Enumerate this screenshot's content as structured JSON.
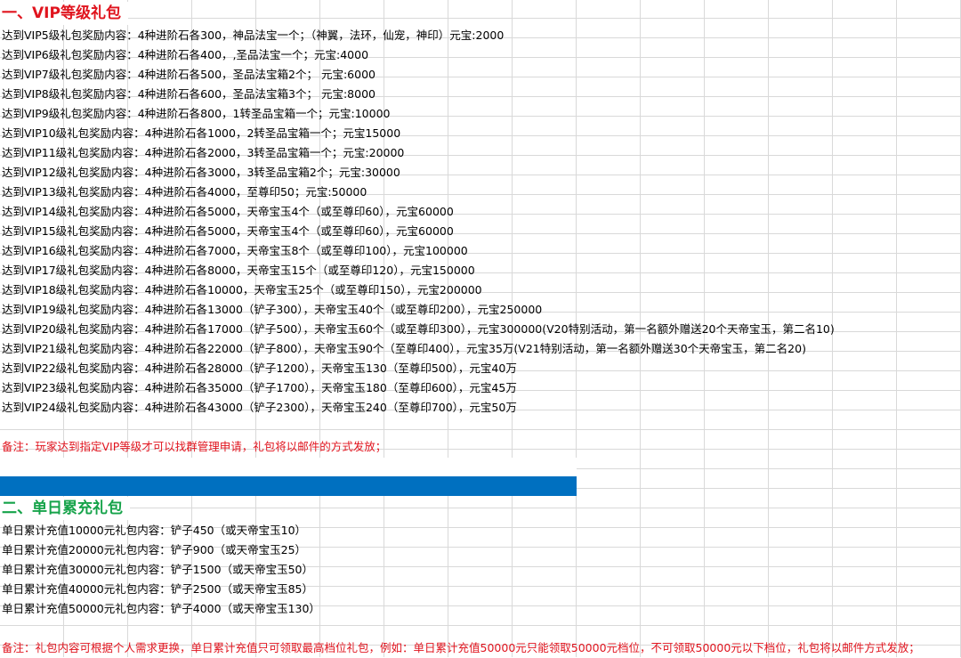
{
  "section1": {
    "title": "一、VIP等级礼包",
    "rows": [
      "达到VIP5级礼包奖励内容：4种进阶石各300，神品法宝一个；（神翼，法环，仙宠，神印）元宝:2000",
      "达到VIP6级礼包奖励内容：4种进阶石各400，,圣品法宝一个；元宝:4000",
      "达到VIP7级礼包奖励内容：4种进阶石各500，圣品法宝箱2个； 元宝:6000",
      "达到VIP8级礼包奖励内容：4种进阶石各600，圣品法宝箱3个； 元宝:8000",
      "达到VIP9级礼包奖励内容：4种进阶石各800，1转圣品宝箱一个；元宝:10000",
      "达到VIP10级礼包奖励内容：4种进阶石各1000，2转圣品宝箱一个；元宝15000",
      "达到VIP11级礼包奖励内容：4种进阶石各2000，3转圣品宝箱一个；元宝:20000",
      "达到VIP12级礼包奖励内容：4种进阶石各3000，3转圣品宝箱2个；元宝:30000",
      "达到VIP13级礼包奖励内容：4种进阶石各4000，至尊印50；元宝:50000",
      "达到VIP14级礼包奖励内容：4种进阶石各5000，天帝宝玉4个（或至尊印60），元宝60000",
      "达到VIP15级礼包奖励内容：4种进阶石各5000，天帝宝玉4个（或至尊印60），元宝60000",
      "达到VIP16级礼包奖励内容：4种进阶石各7000，天帝宝玉8个（或至尊印100），元宝100000",
      "达到VIP17级礼包奖励内容：4种进阶石各8000，天帝宝玉15个（或至尊印120），元宝150000",
      "达到VIP18级礼包奖励内容：4种进阶石各10000，天帝宝玉25个（或至尊印150），元宝200000",
      "达到VIP19级礼包奖励内容：4种进阶石各13000（铲子300），天帝宝玉40个（或至尊印200），元宝250000",
      "达到VIP20级礼包奖励内容：4种进阶石各17000（铲子500），天帝宝玉60个（或至尊印300），元宝300000(V20特别活动，第一名额外赠送20个天帝宝玉，第二名10)",
      "达到VIP21级礼包奖励内容：4种进阶石各22000（铲子800），天帝宝玉90个（至尊印400），元宝35万(V21特别活动，第一名额外赠送30个天帝宝玉，第二名20)",
      "达到VIP22级礼包奖励内容：4种进阶石各28000（铲子1200），天帝宝玉130（至尊印500），元宝40万",
      "达到VIP23级礼包奖励内容：4种进阶石各35000（铲子1700），天帝宝玉180（至尊印600），元宝45万",
      "达到VIP24级礼包奖励内容：4种进阶石各43000（铲子2300），天帝宝玉240（至尊印700），元宝50万"
    ],
    "note": "备注：玩家达到指定VIP等级才可以找群管理申请，礼包将以邮件的方式发放；"
  },
  "section2": {
    "title": "二、单日累充礼包",
    "rows": [
      "单日累计充值10000元礼包内容：铲子450（或天帝宝玉10）",
      "单日累计充值20000元礼包内容：铲子900（或天帝宝玉25）",
      "单日累计充值30000元礼包内容：铲子1500（或天帝宝玉50）",
      "单日累计充值40000元礼包内容：铲子2500（或天帝宝玉85）",
      "单日累计充值50000元礼包内容：铲子4000（或天帝宝玉130）"
    ],
    "note": "备注：礼包内容可根据个人需求更换，单日累计充值只可领取最高档位礼包，例如：单日累计充值50000元只能领取50000元档位，不可领取50000元以下档位，礼包将以邮件方式发放；"
  },
  "colors": {
    "section1_title": "#e0141e",
    "section2_title": "#16a34a",
    "note": "#e0141e",
    "divider_bar": "#0070c0",
    "grid": "#d9d9d9"
  }
}
